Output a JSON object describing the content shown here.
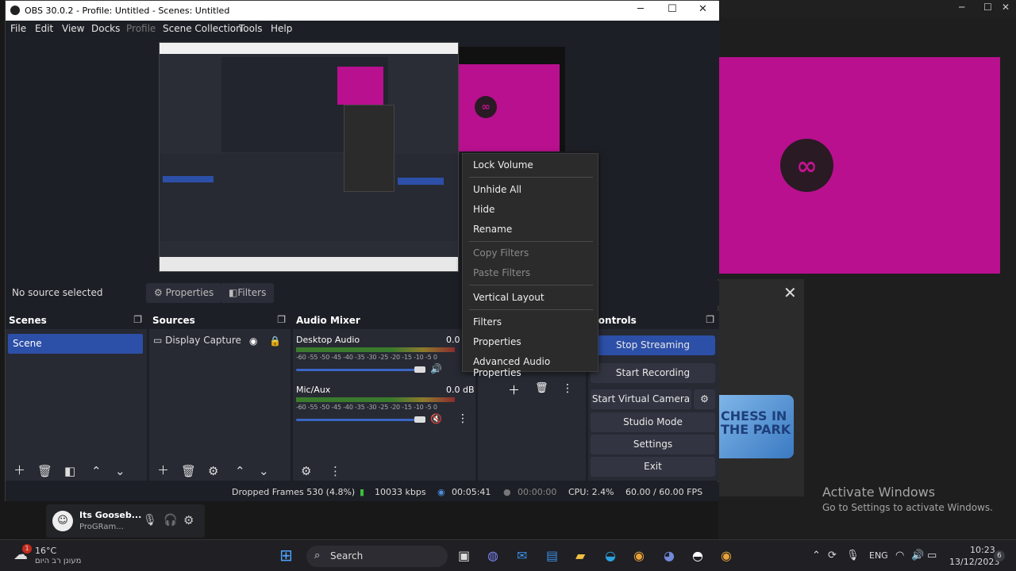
{
  "obs": {
    "title": "OBS 30.0.2 - Profile: Untitled - Scenes: Untitled",
    "menus": [
      "File",
      "Edit",
      "View",
      "Docks",
      "Profile",
      "Scene Collection",
      "Tools",
      "Help"
    ],
    "no_source": "No source selected",
    "properties": "Properties",
    "filters": "Filters",
    "docks": {
      "scenes": "Scenes",
      "sources": "Sources",
      "audio": "Audio Mixer",
      "controls": "Controls"
    },
    "scene": "Scene",
    "source": "Display Capture",
    "audio": [
      {
        "name": "Desktop Audio",
        "db": "0.0"
      },
      {
        "name": "Mic/Aux",
        "db": "0.0 dB"
      }
    ],
    "scale": "-60 -55 -50 -45 -40 -35 -30 -25 -20 -15 -10 -5 0",
    "controls": [
      "Stop Streaming",
      "Start Recording",
      "Start Virtual Camera",
      "Studio Mode",
      "Settings",
      "Exit"
    ],
    "status": {
      "dropped": "Dropped Frames 530 (4.8%)",
      "kbps": "10033 kbps",
      "stream_time": "00:05:41",
      "rec_time": "00:00:00",
      "cpu": "CPU: 2.4%",
      "fps": "60.00 / 60.00 FPS"
    }
  },
  "context_menu": {
    "items": [
      "Lock Volume",
      "Unhide All",
      "Hide",
      "Rename",
      "Copy Filters",
      "Paste Filters",
      "Vertical Layout",
      "Filters",
      "Properties",
      "Advanced Audio Properties"
    ],
    "disabled": [
      "Copy Filters",
      "Paste Filters"
    ]
  },
  "background": {
    "chess": "CHESS IN THE PARK",
    "activate_title": "Activate Windows",
    "activate_sub": "Go to Settings to activate Windows."
  },
  "discord": {
    "user": "Its Gooseb...",
    "status": "ProGRam..."
  },
  "taskbar": {
    "weather_temp": "16°C",
    "weather_text": "מעונן רב היום",
    "search": "Search",
    "lang": "ENG",
    "time": "10:23",
    "date": "13/12/2023",
    "badge": "6",
    "weather_badge": "1"
  },
  "colors": {
    "accent": "#2c4fa8",
    "magenta": "#b8108f"
  }
}
